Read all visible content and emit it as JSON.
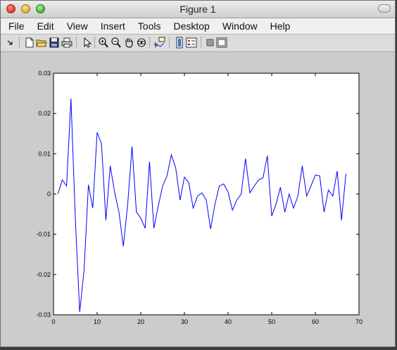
{
  "window": {
    "title": "Figure 1"
  },
  "menu": [
    "File",
    "Edit",
    "View",
    "Insert",
    "Tools",
    "Desktop",
    "Window",
    "Help"
  ],
  "toolbar": [
    {
      "name": "dock-arrow-icon"
    },
    {
      "name": "new-figure-icon"
    },
    {
      "name": "open-file-icon"
    },
    {
      "name": "save-icon"
    },
    {
      "name": "print-icon"
    },
    {
      "name": "edit-plot-arrow-icon"
    },
    {
      "name": "zoom-in-icon"
    },
    {
      "name": "zoom-out-icon"
    },
    {
      "name": "pan-hand-icon"
    },
    {
      "name": "rotate-3d-icon"
    },
    {
      "name": "data-cursor-icon"
    },
    {
      "name": "insert-colorbar-icon"
    },
    {
      "name": "insert-legend-icon"
    },
    {
      "name": "hide-plot-tools-icon"
    },
    {
      "name": "show-plot-tools-icon"
    }
  ],
  "chart_data": {
    "type": "line",
    "title": "",
    "xlabel": "",
    "ylabel": "",
    "xlim": [
      0,
      70
    ],
    "ylim": [
      -0.03,
      0.03
    ],
    "xticks": [
      "0",
      "10",
      "20",
      "30",
      "40",
      "50",
      "60",
      "70"
    ],
    "yticks": [
      "0.03",
      "0.02",
      "0.01",
      "0",
      "-0.01",
      "-0.02",
      "-0.03"
    ],
    "grid": false,
    "line_color": "#0000ff",
    "series": [
      {
        "x": [
          1,
          2,
          3,
          4,
          5,
          6,
          7,
          8,
          9,
          10,
          11,
          12,
          13,
          14,
          15,
          16,
          17,
          18,
          19,
          20,
          21,
          22,
          23,
          24,
          25,
          26,
          27,
          28,
          29,
          30,
          31,
          32,
          33,
          34,
          35,
          36,
          37,
          38,
          39,
          40,
          41,
          42,
          43,
          44,
          45,
          46,
          47,
          48,
          49,
          50,
          51,
          52,
          53,
          54,
          55,
          56,
          57,
          58,
          59,
          60,
          61,
          62,
          63,
          64,
          65,
          66,
          67
        ],
        "y": [
          0.0,
          0.0035,
          0.002,
          0.0237,
          -0.006,
          -0.0293,
          -0.019,
          0.0023,
          -0.0035,
          0.0153,
          0.0125,
          -0.0065,
          0.007,
          0.0005,
          -0.0045,
          -0.013,
          -0.0025,
          0.0118,
          -0.0045,
          -0.006,
          -0.0085,
          0.008,
          -0.0085,
          -0.003,
          0.002,
          0.0045,
          0.0097,
          0.0065,
          -0.0015,
          0.0042,
          0.0028,
          -0.0035,
          -0.0005,
          0.0003,
          -0.0015,
          -0.0087,
          -0.0025,
          0.002,
          0.0025,
          0.0005,
          -0.004,
          -0.0015,
          0.0,
          0.0088,
          0.0003,
          0.002,
          0.0035,
          0.004,
          0.0095,
          -0.0055,
          -0.0025,
          0.0017,
          -0.0045,
          0.0,
          -0.0035,
          -0.0005,
          0.007,
          -0.0005,
          0.002,
          0.0047,
          0.0045,
          -0.0045,
          0.001,
          -0.0005,
          0.0057,
          -0.0065,
          0.005
        ]
      }
    ]
  }
}
